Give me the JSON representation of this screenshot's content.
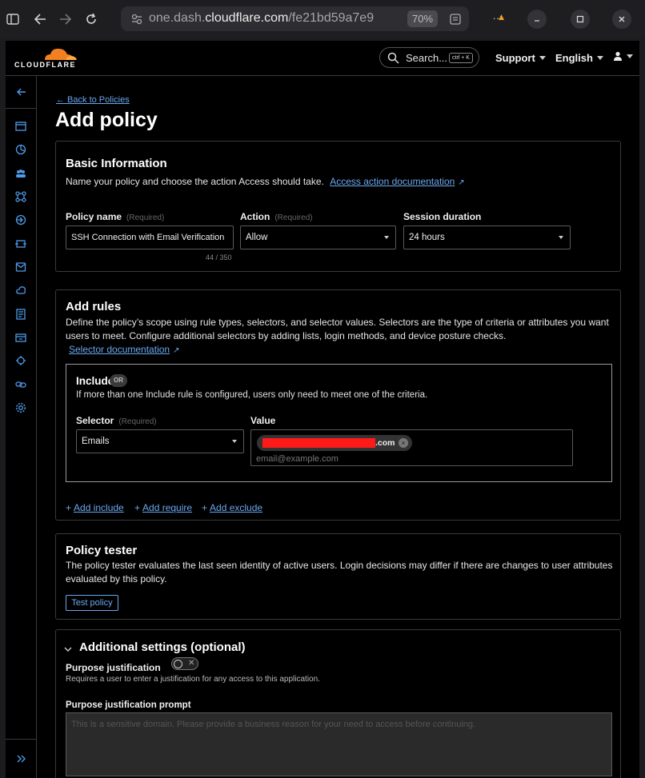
{
  "browser": {
    "url_prefix": "one.dash.",
    "url_domain": "cloudflare.com",
    "url_path": "/fe21bd59a7e9",
    "zoom": "70%",
    "more_label": "···"
  },
  "topnav": {
    "logo_text": "CLOUDFLARE",
    "search_label": "Search...",
    "search_shortcut": "ctrl + K",
    "support_label": "Support",
    "language_label": "English"
  },
  "page": {
    "back_link": "← Back to Policies",
    "title": "Add policy"
  },
  "basic_info": {
    "title": "Basic Information",
    "description": "Name your policy and choose the action Access should take.",
    "doc_link": "Access action documentation",
    "policy_name_label": "Policy name",
    "required_label": "(Required)",
    "policy_name_value": "SSH Connection with Email Verification",
    "char_count": "44 / 350",
    "action_label": "Action",
    "action_value": "Allow",
    "session_label": "Session duration",
    "session_value": "24 hours"
  },
  "add_rules": {
    "title": "Add rules",
    "description": "Define the policy’s scope using rule types, selectors, and selector values. Selectors are the type of criteria or attributes you want users to meet. Configure additional selectors by adding lists, login methods, and device posture checks.",
    "doc_link": "Selector documentation",
    "include": {
      "title": "Include",
      "badge": "OR",
      "description": "If more than one Include rule is configured, users only need to meet one of the criteria.",
      "selector_label": "Selector",
      "selector_required": "(Required)",
      "selector_value": "Emails",
      "value_label": "Value",
      "chip_suffix": ".com",
      "value_placeholder": "email@example.com"
    },
    "add_include": "Add include",
    "add_require": "Add require",
    "add_exclude": "Add exclude"
  },
  "policy_tester": {
    "title": "Policy tester",
    "description": "The policy tester evaluates the last seen identity of active users. Login decisions may differ if there are changes to user attributes evaluated by this policy.",
    "button": "Test policy"
  },
  "additional": {
    "title": "Additional settings (optional)",
    "purpose_label": "Purpose justification",
    "purpose_desc": "Requires a user to enter a justification for any access to this application.",
    "prompt_label": "Purpose justification prompt",
    "prompt_placeholder": "This is a sensitive domain. Please provide a business reason for your need to access before continuing."
  },
  "colors": {
    "accent": "#4d9bea",
    "link": "#6aa8f0",
    "redaction": "#ff1a1a",
    "logo_orange": "#f38020"
  }
}
